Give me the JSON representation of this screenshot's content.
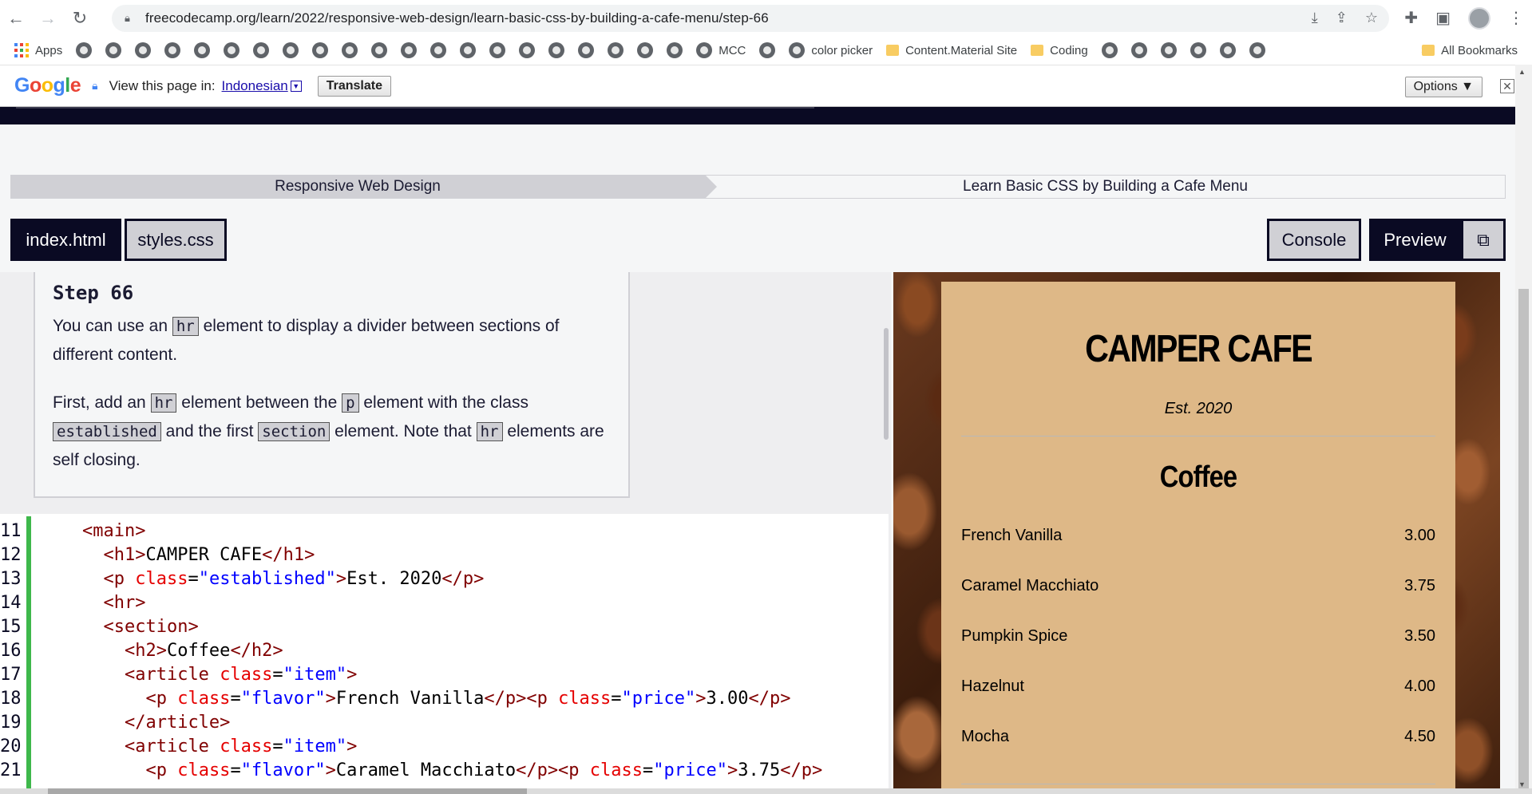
{
  "browser": {
    "url": "freecodecamp.org/learn/2022/responsive-web-design/learn-basic-css-by-building-a-cafe-menu/step-66",
    "bookmarks": {
      "apps_label": "Apps",
      "mcc": "MCC",
      "color_picker": "color picker",
      "content_material": "Content.Material Site",
      "coding": "Coding",
      "all_bookmarks": "All Bookmarks",
      "more": "»"
    },
    "translate_bar": {
      "view_text": "View this page in:",
      "language": "Indonesian",
      "translate_button": "Translate",
      "options_button": "Options ▼"
    }
  },
  "breadcrumb": {
    "superblock": "Responsive Web Design",
    "block": "Learn Basic CSS by Building a Cafe Menu"
  },
  "tabs": {
    "index": "index.html",
    "styles": "styles.css",
    "console": "Console",
    "preview": "Preview"
  },
  "instructions": {
    "title": "Step 66",
    "p1_a": "You can use an ",
    "p1_code": "hr",
    "p1_b": " element to display a divider between sections of different content.",
    "p2_a": "First, add an ",
    "p2_code1": "hr",
    "p2_b": " element between the ",
    "p2_code2": "p",
    "p2_c": " element with the class ",
    "p2_code3": "established",
    "p2_d": " and the first ",
    "p2_code4": "section",
    "p2_e": " element. Note that ",
    "p2_code5": "hr",
    "p2_f": " elements are self closing."
  },
  "code": {
    "lines": [
      {
        "n": "11",
        "indent": "    ",
        "parts": [
          [
            "tag",
            "<main>"
          ]
        ]
      },
      {
        "n": "12",
        "indent": "      ",
        "parts": [
          [
            "tag",
            "<h1>"
          ],
          [
            "txt",
            "CAMPER CAFE"
          ],
          [
            "tag",
            "</h1>"
          ]
        ]
      },
      {
        "n": "13",
        "indent": "      ",
        "parts": [
          [
            "tag",
            "<p "
          ],
          [
            "attr",
            "class"
          ],
          [
            "txt",
            "="
          ],
          [
            "str",
            "\"established\""
          ],
          [
            "tag",
            ">"
          ],
          [
            "txt",
            "Est. 2020"
          ],
          [
            "tag",
            "</p>"
          ]
        ]
      },
      {
        "n": "14",
        "indent": "      ",
        "parts": [
          [
            "tag",
            "<hr>"
          ]
        ]
      },
      {
        "n": "15",
        "indent": "      ",
        "parts": [
          [
            "tag",
            "<section>"
          ]
        ]
      },
      {
        "n": "16",
        "indent": "        ",
        "parts": [
          [
            "tag",
            "<h2>"
          ],
          [
            "txt",
            "Coffee"
          ],
          [
            "tag",
            "</h2>"
          ]
        ]
      },
      {
        "n": "17",
        "indent": "        ",
        "parts": [
          [
            "tag",
            "<article "
          ],
          [
            "attr",
            "class"
          ],
          [
            "txt",
            "="
          ],
          [
            "str",
            "\"item\""
          ],
          [
            "tag",
            ">"
          ]
        ]
      },
      {
        "n": "18",
        "indent": "          ",
        "parts": [
          [
            "tag",
            "<p "
          ],
          [
            "attr",
            "class"
          ],
          [
            "txt",
            "="
          ],
          [
            "str",
            "\"flavor\""
          ],
          [
            "tag",
            ">"
          ],
          [
            "txt",
            "French Vanilla"
          ],
          [
            "tag",
            "</p><p "
          ],
          [
            "attr",
            "class"
          ],
          [
            "txt",
            "="
          ],
          [
            "str",
            "\"price\""
          ],
          [
            "tag",
            ">"
          ],
          [
            "txt",
            "3.00"
          ],
          [
            "tag",
            "</p>"
          ]
        ]
      },
      {
        "n": "19",
        "indent": "        ",
        "parts": [
          [
            "tag",
            "</article>"
          ]
        ]
      },
      {
        "n": "20",
        "indent": "        ",
        "parts": [
          [
            "tag",
            "<article "
          ],
          [
            "attr",
            "class"
          ],
          [
            "txt",
            "="
          ],
          [
            "str",
            "\"item\""
          ],
          [
            "tag",
            ">"
          ]
        ]
      },
      {
        "n": "21",
        "indent": "          ",
        "parts": [
          [
            "tag",
            "<p "
          ],
          [
            "attr",
            "class"
          ],
          [
            "txt",
            "="
          ],
          [
            "str",
            "\"flavor\""
          ],
          [
            "tag",
            ">"
          ],
          [
            "txt",
            "Caramel Macchiato"
          ],
          [
            "tag",
            "</p><p "
          ],
          [
            "attr",
            "class"
          ],
          [
            "txt",
            "="
          ],
          [
            "str",
            "\"price\""
          ],
          [
            "tag",
            ">"
          ],
          [
            "txt",
            "3.75"
          ],
          [
            "tag",
            "</p>"
          ]
        ]
      }
    ]
  },
  "preview": {
    "title": "CAMPER CAFE",
    "established": "Est. 2020",
    "section_title": "Coffee",
    "items": [
      {
        "flavor": "French Vanilla",
        "price": "3.00"
      },
      {
        "flavor": "Caramel Macchiato",
        "price": "3.75"
      },
      {
        "flavor": "Pumpkin Spice",
        "price": "3.50"
      },
      {
        "flavor": "Hazelnut",
        "price": "4.00"
      },
      {
        "flavor": "Mocha",
        "price": "4.50"
      }
    ]
  }
}
